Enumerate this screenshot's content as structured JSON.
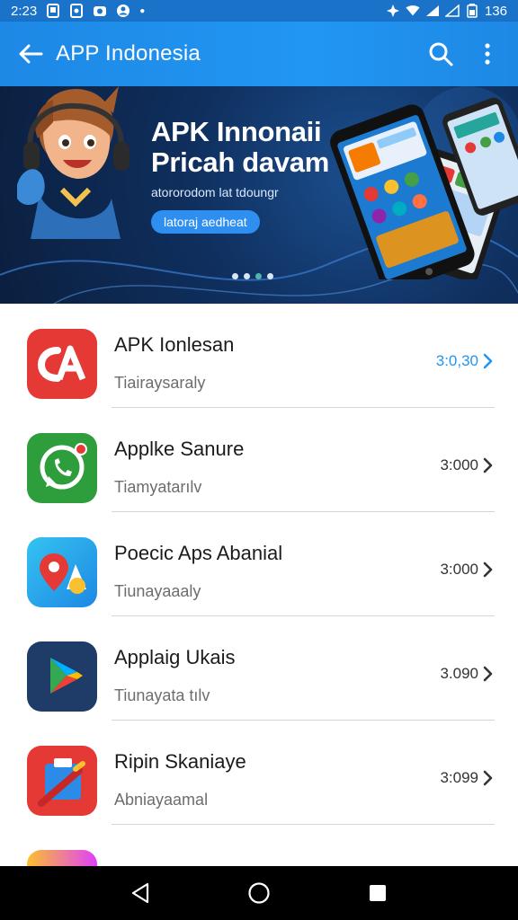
{
  "status_bar": {
    "time": "2:23",
    "battery": "136"
  },
  "app_bar": {
    "title": "APP Indonesia"
  },
  "banner": {
    "title_line1": "APK Innonaii",
    "title_line2": "Pricah davam",
    "subtitle": "atororodom lat tdoungr",
    "cta": "latoraj aedheat",
    "dots_total": 4,
    "active_dot_index": 2
  },
  "apps": [
    {
      "name": "APK Ionlesan",
      "subtitle": "Tiairaysaraly",
      "price": "3:0,30",
      "icon": "apk-logo-icon",
      "color": "#e53935"
    },
    {
      "name": "Applke Sanure",
      "subtitle": "Tiamyatarılv",
      "price": "3:000",
      "icon": "whatsapp-icon",
      "color": "#2e9e3c"
    },
    {
      "name": "Poecic Aps Abanial",
      "subtitle": "Tiunayaaaly",
      "price": "3:000",
      "icon": "maps-pin-icon",
      "color": "#2ba9e4"
    },
    {
      "name": "Applaig Ukais",
      "subtitle": "Tiunayata tılv",
      "price": "3.090",
      "icon": "play-store-icon",
      "color": "#1f3b67"
    },
    {
      "name": "Ripin Skaniaye",
      "subtitle": "Abniayaamal",
      "price": "3:099",
      "icon": "brush-tool-icon",
      "color": "#e53935"
    }
  ]
}
